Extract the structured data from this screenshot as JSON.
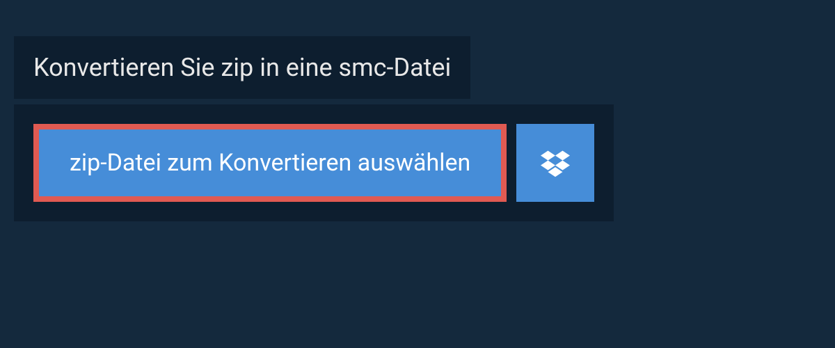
{
  "header": {
    "title": "Konvertieren Sie zip in eine smc-Datei"
  },
  "actions": {
    "select_file_label": "zip-Datei zum Konvertieren auswählen"
  },
  "colors": {
    "page_bg": "#14293d",
    "panel_bg": "#0d1e2f",
    "button_bg": "#468dd8",
    "highlight_border": "#e05a52"
  }
}
